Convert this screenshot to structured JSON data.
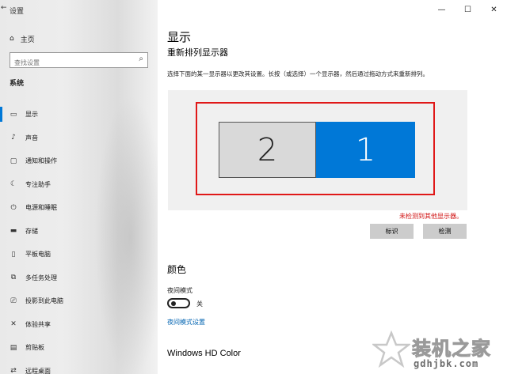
{
  "window": {
    "title": "设置",
    "controls": {
      "minimize": "—",
      "maximize": "☐",
      "close": "✕"
    }
  },
  "sidebar": {
    "home_label": "主页",
    "search_placeholder": "查找设置",
    "section": "系统",
    "items": [
      {
        "label": "显示",
        "icon": "display-icon",
        "glyph": "▭",
        "active": true
      },
      {
        "label": "声音",
        "icon": "sound-icon",
        "glyph": "♪",
        "active": false
      },
      {
        "label": "通知和操作",
        "icon": "notification-icon",
        "glyph": "▢",
        "active": false
      },
      {
        "label": "专注助手",
        "icon": "moon-icon",
        "glyph": "☾",
        "active": false
      },
      {
        "label": "电源和睡眠",
        "icon": "power-icon",
        "glyph": "⏻",
        "active": false
      },
      {
        "label": "存储",
        "icon": "storage-icon",
        "glyph": "▬",
        "active": false
      },
      {
        "label": "平板电脑",
        "icon": "tablet-icon",
        "glyph": "▯",
        "active": false
      },
      {
        "label": "多任务处理",
        "icon": "multitask-icon",
        "glyph": "⧉",
        "active": false
      },
      {
        "label": "投影到此电脑",
        "icon": "project-icon",
        "glyph": "⎚",
        "active": false
      },
      {
        "label": "体验共享",
        "icon": "share-icon",
        "glyph": "✕",
        "active": false
      },
      {
        "label": "剪贴板",
        "icon": "clipboard-icon",
        "glyph": "▤",
        "active": false
      },
      {
        "label": "远程桌面",
        "icon": "remote-desktop-icon",
        "glyph": "⇄",
        "active": false
      }
    ]
  },
  "main": {
    "title": "显示",
    "subtitle": "重新排列显示器",
    "description": "选择下面的某一显示器以更改其设置。长按（或选择）一个显示器，然后通过拖动方式来重新排列。",
    "monitors": [
      {
        "number": "2",
        "selected": false
      },
      {
        "number": "1",
        "selected": true
      }
    ],
    "warning": "未检测到其他显示器。",
    "identify_button": "标识",
    "detect_button": "检测",
    "color_heading": "颜色",
    "night_light_label": "夜间模式",
    "night_light_state": "关",
    "night_light_link": "夜间模式设置",
    "hd_color_heading": "Windows HD Color"
  },
  "watermark": {
    "text": "装机之家",
    "url": "gdhjbk.com"
  },
  "colors": {
    "accent": "#0078d7",
    "highlight_border": "#e01818",
    "warning_text": "#d01010",
    "link": "#0063b1"
  }
}
